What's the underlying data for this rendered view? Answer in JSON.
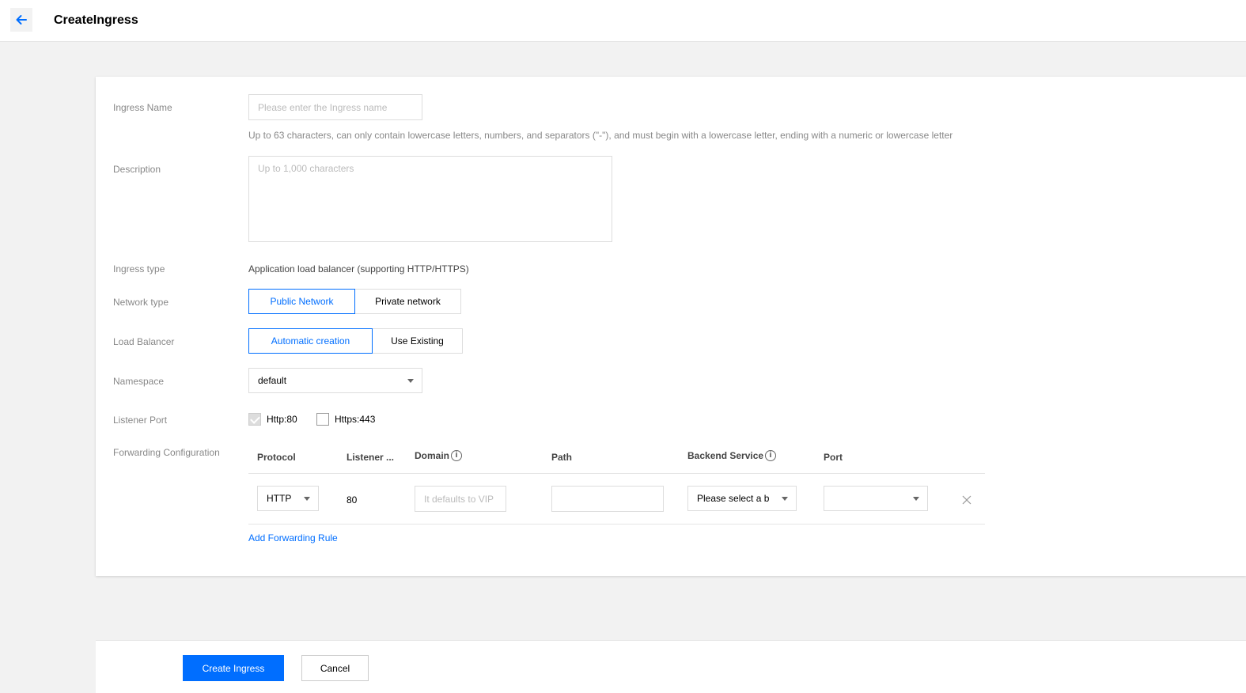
{
  "header": {
    "title": "CreateIngress"
  },
  "form": {
    "ingress_name": {
      "label": "Ingress Name",
      "placeholder": "Please enter the Ingress name",
      "value": "",
      "hint": "Up to 63 characters, can only contain lowercase letters, numbers, and separators (\"-\"), and must begin with a lowercase letter, ending with a numeric or lowercase letter"
    },
    "description": {
      "label": "Description",
      "placeholder": "Up to 1,000 characters",
      "value": ""
    },
    "ingress_type": {
      "label": "Ingress type",
      "value": "Application load balancer (supporting HTTP/HTTPS)"
    },
    "network_type": {
      "label": "Network type",
      "options": [
        "Public Network",
        "Private network"
      ],
      "selected": "Public Network"
    },
    "load_balancer": {
      "label": "Load Balancer",
      "options": [
        "Automatic creation",
        "Use Existing"
      ],
      "selected": "Automatic creation"
    },
    "namespace": {
      "label": "Namespace",
      "value": "default"
    },
    "listener_port": {
      "label": "Listener Port",
      "options": [
        {
          "label": "Http:80",
          "checked": true,
          "disabled": true
        },
        {
          "label": "Https:443",
          "checked": false
        }
      ]
    },
    "forwarding": {
      "label": "Forwarding Configuration",
      "columns": [
        "Protocol",
        "Listener ...",
        "Domain",
        "Path",
        "Backend Service",
        "Port"
      ],
      "rows": [
        {
          "protocol": "HTTP",
          "listener_port": "80",
          "domain_placeholder": "It defaults to VIP",
          "path": "",
          "backend_service": "Please select a b",
          "port": ""
        }
      ],
      "add_rule": "Add Forwarding Rule"
    }
  },
  "footer": {
    "create_label": "Create Ingress",
    "cancel_label": "Cancel"
  },
  "colors": {
    "accent": "#006eff",
    "background": "#f2f2f2",
    "label": "#888888"
  },
  "icons": [
    "arrow-left-icon",
    "info-icon",
    "close-icon",
    "chevron-down-icon",
    "checkmark-icon"
  ]
}
